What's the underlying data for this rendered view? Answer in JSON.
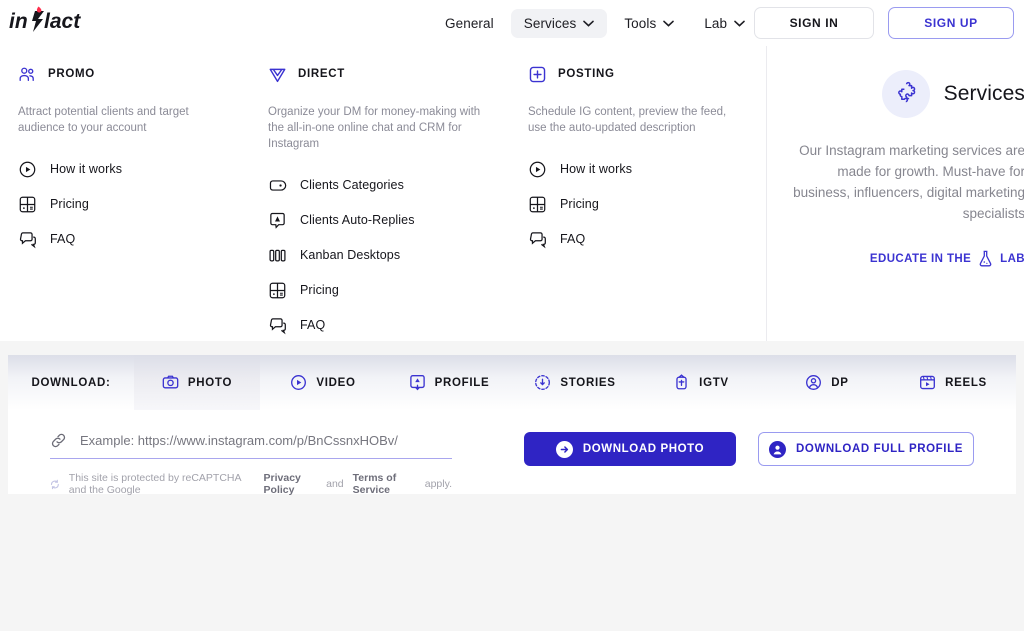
{
  "brand": {
    "name": "inflact",
    "accent": "#3b33d1",
    "primary": "#2f24c4",
    "muted": "#8b8b97"
  },
  "header": {
    "nav": [
      {
        "label": "General",
        "has_caret": false,
        "active": false
      },
      {
        "label": "Services",
        "has_caret": true,
        "active": true
      },
      {
        "label": "Tools",
        "has_caret": true,
        "active": false
      },
      {
        "label": "Lab",
        "has_caret": true,
        "active": false
      }
    ],
    "sign_in": "SIGN IN",
    "sign_up": "SIGN UP"
  },
  "mega": {
    "columns": [
      {
        "title": "PROMO",
        "icon": "people-icon",
        "description": "Attract potential clients and target audience to your account",
        "links": [
          {
            "label": "How it works",
            "icon": "play-circle-icon"
          },
          {
            "label": "Pricing",
            "icon": "grid-price-icon"
          },
          {
            "label": "FAQ",
            "icon": "chat-faq-icon"
          }
        ]
      },
      {
        "title": "DIRECT",
        "icon": "send-icon",
        "description": "Organize your DM for money-making with the all-in-one online chat and CRM for Instagram",
        "links": [
          {
            "label": "Clients Categories",
            "icon": "tag-icon"
          },
          {
            "label": "Clients Auto-Replies",
            "icon": "auto-reply-icon"
          },
          {
            "label": "Kanban Desktops",
            "icon": "kanban-icon"
          },
          {
            "label": "Pricing",
            "icon": "grid-price-icon"
          },
          {
            "label": "FAQ",
            "icon": "chat-faq-icon"
          }
        ]
      },
      {
        "title": "POSTING",
        "icon": "plus-square-icon",
        "description": "Schedule IG content, preview the feed, use the auto-updated description",
        "links": [
          {
            "label": "How it works",
            "icon": "play-circle-icon"
          },
          {
            "label": "Pricing",
            "icon": "grid-price-icon"
          },
          {
            "label": "FAQ",
            "icon": "chat-faq-icon"
          }
        ]
      }
    ],
    "side": {
      "icon": "puzzle-icon",
      "title": "Services",
      "description": "Our Instagram marketing services are made for growth. Must-have for business, influencers, digital marketing specialists",
      "link_pre": "EDUCATE IN THE",
      "link_icon": "flask-icon",
      "link_post": "LAB"
    }
  },
  "download": {
    "tabs": [
      {
        "label": "DOWNLOAD:",
        "icon": "",
        "active": false
      },
      {
        "label": "PHOTO",
        "icon": "camera-icon",
        "active": true
      },
      {
        "label": "VIDEO",
        "icon": "play-circle-icon",
        "active": false
      },
      {
        "label": "PROFILE",
        "icon": "profile-download-icon",
        "active": false
      },
      {
        "label": "STORIES",
        "icon": "stories-icon",
        "active": false
      },
      {
        "label": "IGTV",
        "icon": "igtv-icon",
        "active": false
      },
      {
        "label": "DP",
        "icon": "user-circle-icon",
        "active": false
      },
      {
        "label": "REELS",
        "icon": "reels-icon",
        "active": false
      }
    ],
    "input": {
      "icon": "link-icon",
      "value": "",
      "placeholder": "Example: https://www.instagram.com/p/BnCssnxHOBv/"
    },
    "captcha": {
      "icon": "recaptcha-icon",
      "text_before": "This site is protected by reCAPTCHA and the Google",
      "privacy_link": "Privacy Policy",
      "text_mid": "and",
      "terms_link": "Terms of Service",
      "text_after": "apply."
    },
    "primary_button": {
      "label": "DOWNLOAD PHOTO",
      "icon": "arrow-right-circle-icon"
    },
    "secondary_button": {
      "label": "DOWNLOAD FULL PROFILE",
      "icon": "avatar-circle-icon"
    }
  }
}
